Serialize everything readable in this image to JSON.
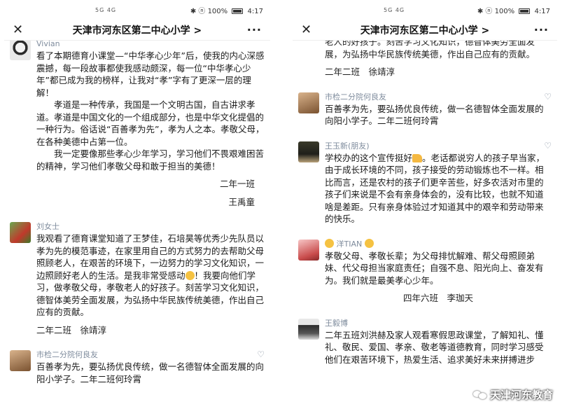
{
  "status": {
    "signal": "5G 4G",
    "right": "✱ ⓝ 100%",
    "time": "4:17"
  },
  "left": {
    "title": "天津市河东区第二中心小学 >",
    "comments": [
      {
        "name": "Vivian",
        "text": "看了本期德育小课堂—“中华孝心少年”后，使我的内心深感震撼，每一段故事都使我感动颇深，每一位“中华孝心少年”都已成为我的榜样，让我对“孝”字有了更深一层的理解！\n　　孝道是一种传承，我国是一个文明古国，自古讲求孝道。孝道是中国文化的一个组成部分，也是中华文化提倡的一种行为。俗话说“百善孝为先”，孝为人之本。孝敬父母，在各种美德中占第一位。\n　　我一定要像那些孝心少年学习，学习他们不畏艰难困苦的精神，学习他们孝敬父母和敢于担当的美德！",
        "sign1": "二年一班",
        "sign2": "王禹童"
      },
      {
        "name": "刘女士",
        "text_a": "我观看了德育课堂知道了王梦佳，石培昊等优秀少先队员以孝为先的模范事迹，在家里用自己的方式努力的去帮助父母照顾老人，在艰苦的环境下，一边努力的学习文化知识，一边照顾好老人的生活。是我非常受感动",
        "text_b": "！我要向他们学习，做孝敬父母，孝敬老人的好孩子。刻苦学习文化知识，德智体美劳全面发展，为弘扬中华民族传统美德，作出自己应有的贡献。",
        "sign": "二年二班　徐靖淳"
      },
      {
        "name": "市检二分院何良友",
        "text": "百善孝为先，要弘扬优良传统，做一名德智体全面发展的向阳小学子。二年二班何玲霄"
      }
    ]
  },
  "right": {
    "title": "天津市河东区第二中心小学 >",
    "partial_text": "老人的好孩子。刻苦学习文化知识，德智体美劳全面发展，为弘扬中华民族传统美德，作出自己应有的贡献。",
    "partial_sign": "二年二班　徐靖淳",
    "comments": [
      {
        "name": "市检二分院何良友",
        "text": "百善孝为先，要弘扬优良传统，做一名德智体全面发展的向阳小学子。二年二班何玲霄"
      },
      {
        "name": "王玉新(朋友)",
        "text_a": "学校办的这个宣传挺好",
        "text_b": "。老话都说穷人的孩子早当家，由于成长环境的不同，孩子接受的劳动锻炼也不一样。相比而言，还是农村的孩子们更辛苦些，好多农活对市里的孩子们来说是不会有亲身体会的，没有比较，也就不知道啥是差距。只有亲身体验过才知道其中的艰辛和劳动带来的快乐。"
      },
      {
        "name": "洋TIAN",
        "text": "孝敬父母、孝敬长辈；为父母排忧解难、帮父母照顾弟妹、代父母担当家庭责任；自强不息、阳光向上、奋发有为。我们就是最美孝心少年。",
        "sign": "四年六班　李珈天"
      },
      {
        "name": "王毅博",
        "text": "二年五班刘洪赫及家人观看寒假思政课堂，了解知礼、懂礼、敬民、爱国、孝亲、敬老等道德教育，同时学习感受他们在艰苦环境下，热爱生活、追求美好未来拼搏进步"
      }
    ]
  },
  "icons": {
    "close": "close-icon",
    "more": "more-icon",
    "like": "like-icon"
  },
  "watermark": "天津河东教育"
}
